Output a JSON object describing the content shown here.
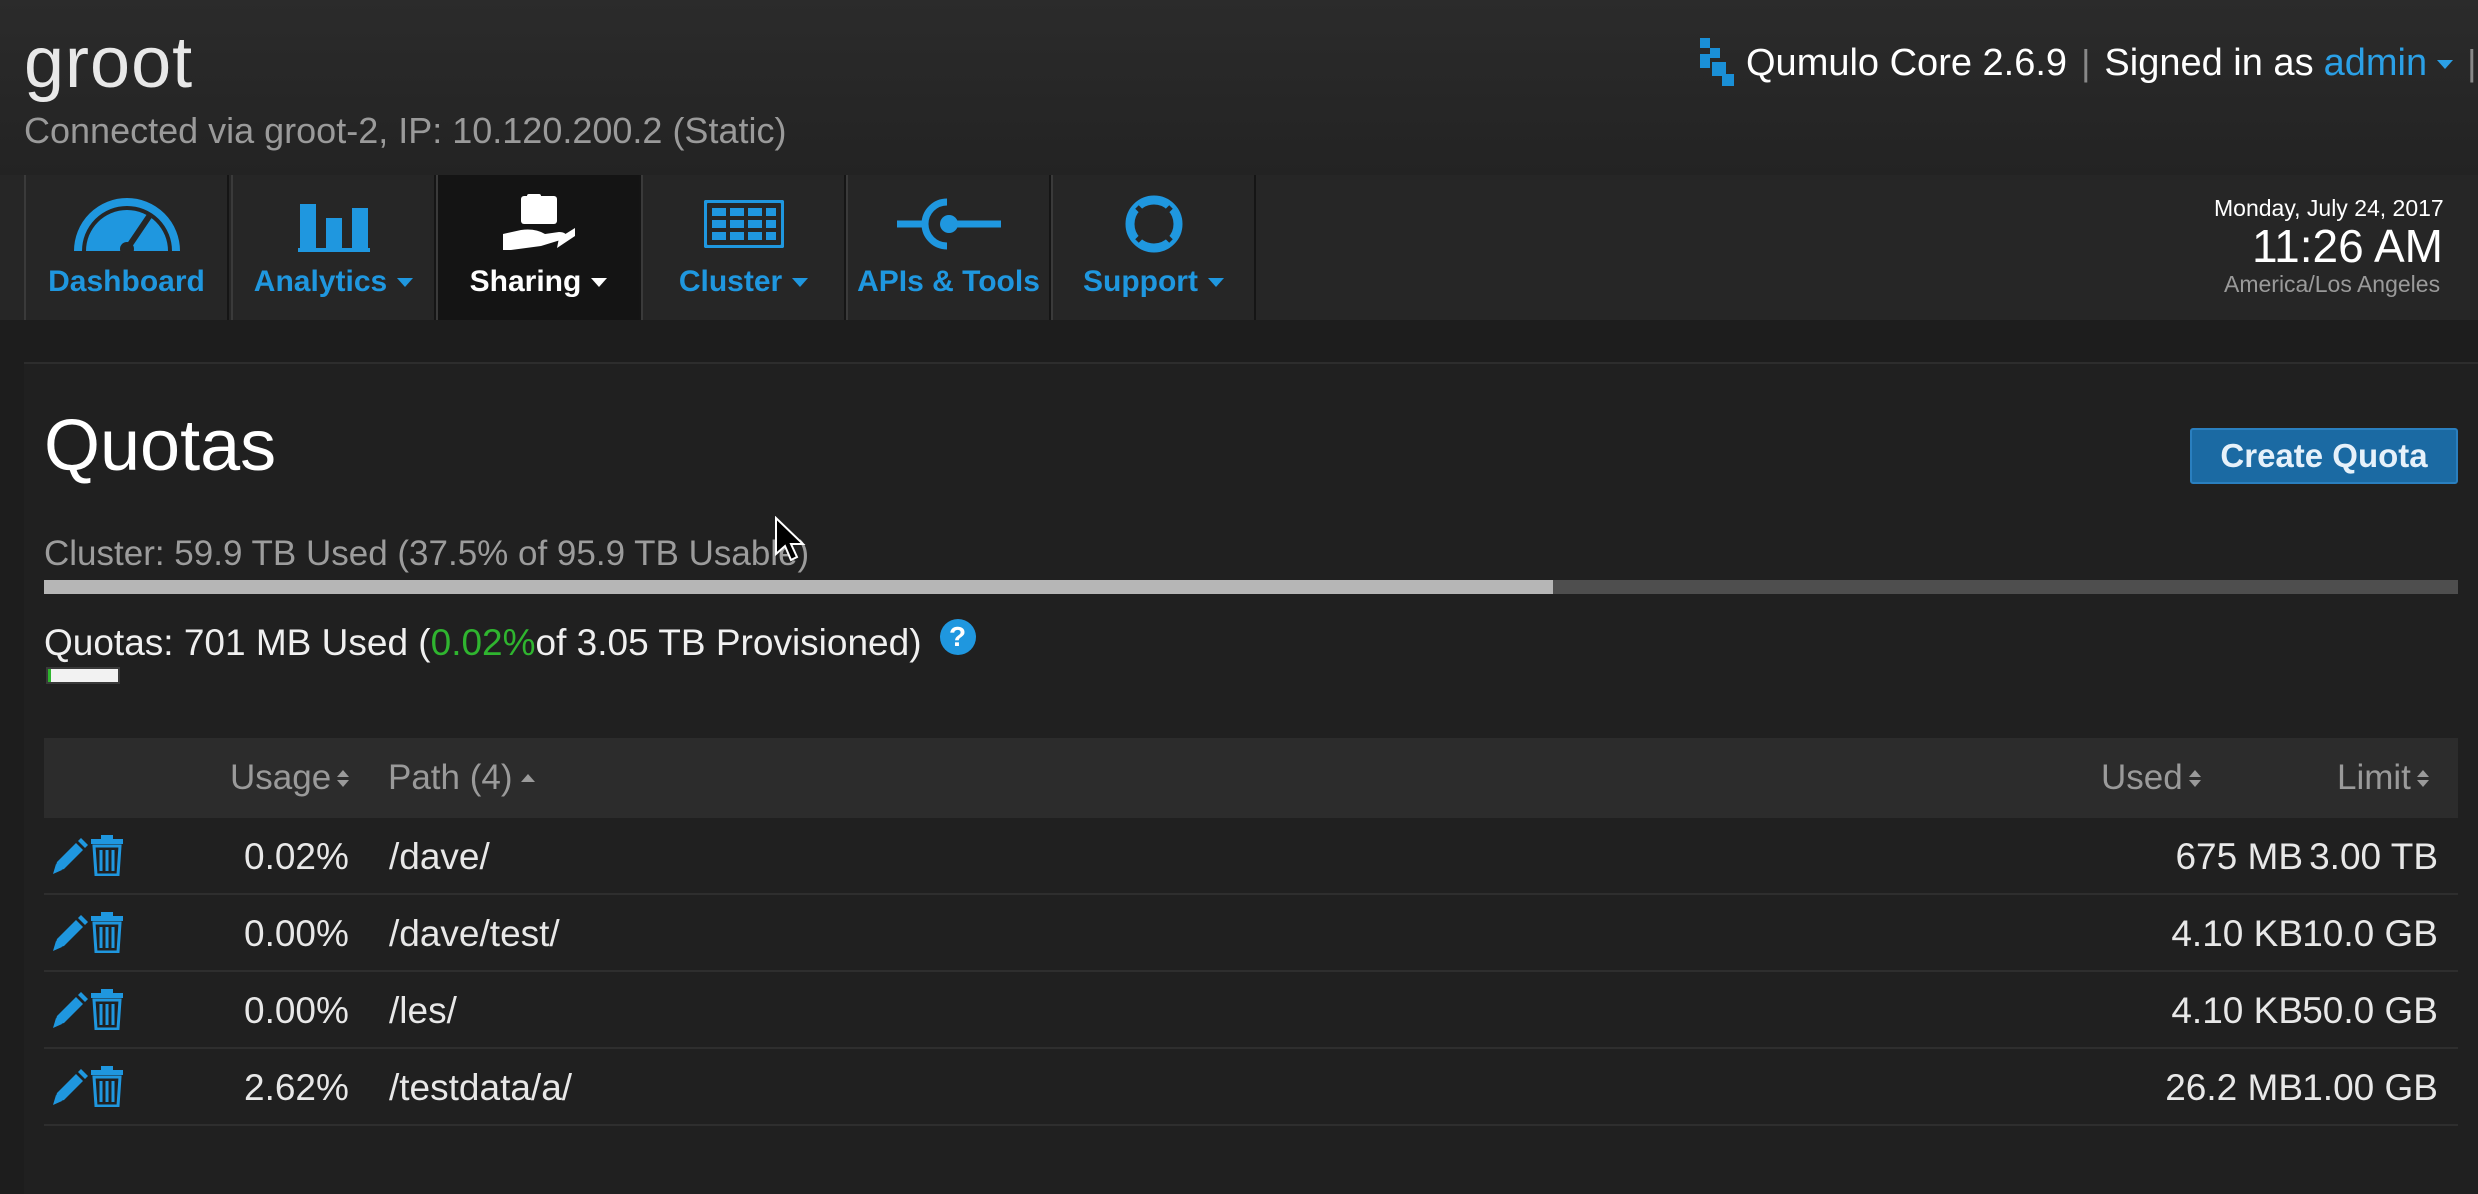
{
  "header": {
    "cluster_name": "groot",
    "connection": "Connected via groot-2, IP: 10.120.200.2 (Static)",
    "product": "Qumulo Core 2.6.9",
    "signed_in_label": "Signed in as",
    "username": "admin",
    "separator": "|"
  },
  "nav": {
    "items": [
      {
        "label": "Dashboard",
        "icon": "gauge-icon",
        "dropdown": false
      },
      {
        "label": "Analytics",
        "icon": "bar-chart-icon",
        "dropdown": true
      },
      {
        "label": "Sharing",
        "icon": "sharing-hand-icon",
        "dropdown": true,
        "active": true
      },
      {
        "label": "Cluster",
        "icon": "cluster-grid-icon",
        "dropdown": true
      },
      {
        "label": "APIs & Tools",
        "icon": "api-plug-icon",
        "dropdown": false
      },
      {
        "label": "Support",
        "icon": "lifebuoy-icon",
        "dropdown": true
      }
    ]
  },
  "datetime": {
    "date": "Monday, July 24, 2017",
    "time": "11:26 AM",
    "timezone": "America/Los Angeles"
  },
  "page": {
    "title": "Quotas",
    "create_button": "Create Quota",
    "cluster_usage_text": "Cluster: 59.9 TB Used (37.5% of 95.9 TB Usable)",
    "cluster_usage_fraction": 0.625,
    "quotas_prefix": "Quotas: 701 MB Used (",
    "quotas_pct": "0.02%",
    "quotas_suffix": " of 3.05 TB Provisioned)",
    "help_glyph": "?"
  },
  "colors": {
    "accent": "#1f97df",
    "button": "#1b6aa3",
    "percent_green": "#2fb52f"
  },
  "table": {
    "headers": {
      "usage": "Usage",
      "path": "Path (4)",
      "used": "Used",
      "limit": "Limit"
    },
    "rows": [
      {
        "usage": "0.02%",
        "path": "/dave/",
        "used": "675 MB",
        "limit": "3.00 TB"
      },
      {
        "usage": "0.00%",
        "path": "/dave/test/",
        "used": "4.10 KB",
        "limit": "10.0 GB"
      },
      {
        "usage": "0.00%",
        "path": "/les/",
        "used": "4.10 KB",
        "limit": "50.0 GB"
      },
      {
        "usage": "2.62%",
        "path": "/testdata/a/",
        "used": "26.2 MB",
        "limit": "1.00 GB"
      }
    ]
  }
}
